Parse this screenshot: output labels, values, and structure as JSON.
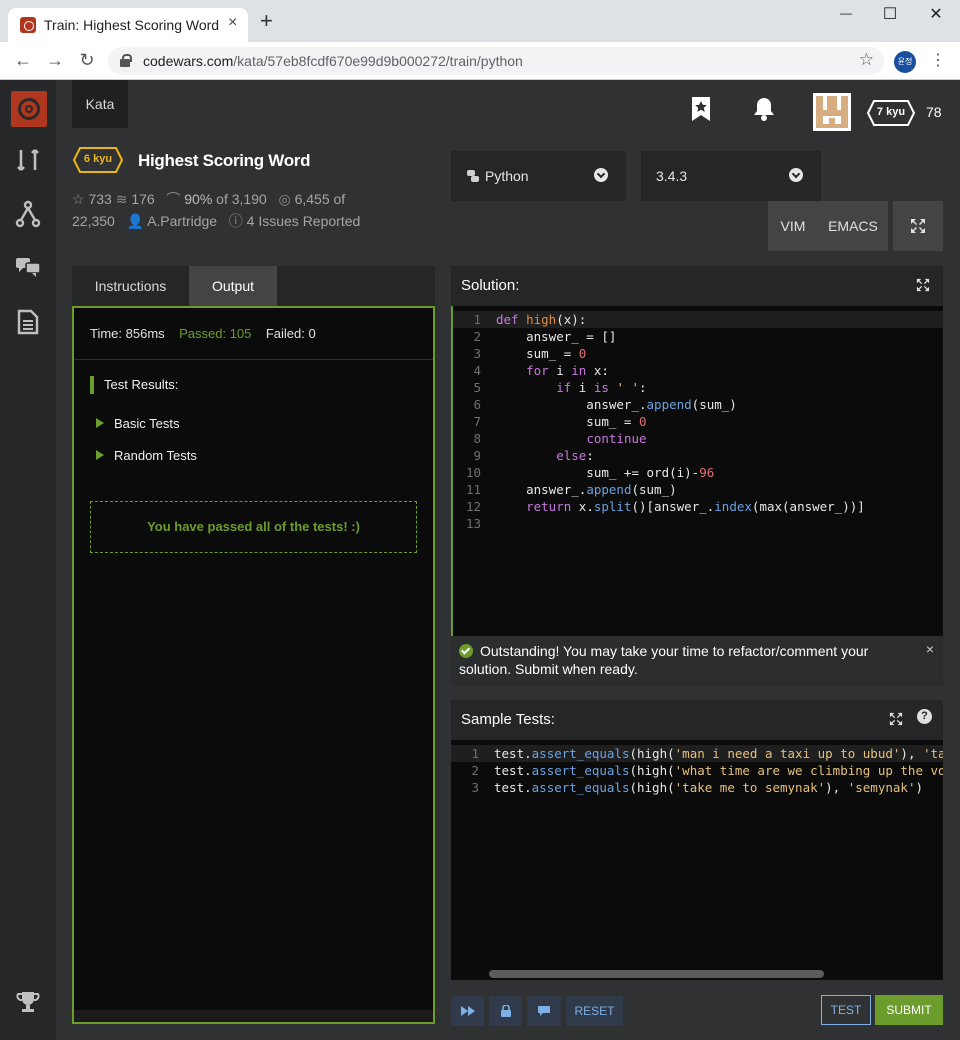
{
  "browser": {
    "tab_title": "Train: Highest Scoring Word",
    "tab_close": "×",
    "new_tab": "+",
    "url_domain": "codewars.com",
    "url_path": "/kata/57eb8fcdf670e99d9b000272/train/python",
    "profile_initials": "윤정",
    "minimize": "—",
    "maximize": "☐",
    "close": "✕"
  },
  "header": {
    "kata_tab": "Kata",
    "rank": "7 kyu",
    "honor": "78"
  },
  "kata": {
    "kyu": "6 kyu",
    "title": "Highest Scoring Word",
    "stars": "733",
    "collections": "176",
    "satisfaction": "90%",
    "satisfaction_of": "of",
    "votes": "3,190",
    "completed": "6,455",
    "completed_of": "of",
    "attempts": "22,350",
    "author": "A.Partridge",
    "issues": "4 Issues Reported"
  },
  "editor_settings": {
    "language": "Python",
    "version": "3.4.3",
    "vim": "VIM",
    "emacs": "EMACS"
  },
  "left_tabs": [
    "Instructions",
    "Output"
  ],
  "output": {
    "time_label": "Time: 856ms",
    "passed_label": "Passed: 105",
    "failed_label": "Failed: 0",
    "results_heading": "Test Results:",
    "groups": [
      "Basic Tests",
      "Random Tests"
    ],
    "success_message": "You have passed all of the tests! :)"
  },
  "solution": {
    "title": "Solution:",
    "line_count": 13
  },
  "notice": {
    "message": "Outstanding! You may take your time to refactor/comment your solution. Submit when ready.",
    "close": "×"
  },
  "sample_tests": {
    "title": "Sample Tests:",
    "help": "?"
  },
  "buttons": {
    "reset": "RESET",
    "test": "TEST",
    "submit": "SUBMIT"
  },
  "colors": {
    "accent_green": "#6c9c2c",
    "brand_red": "#b1361e",
    "rank_yellow": "#ecb613",
    "link_blue": "#7eb0e6"
  }
}
